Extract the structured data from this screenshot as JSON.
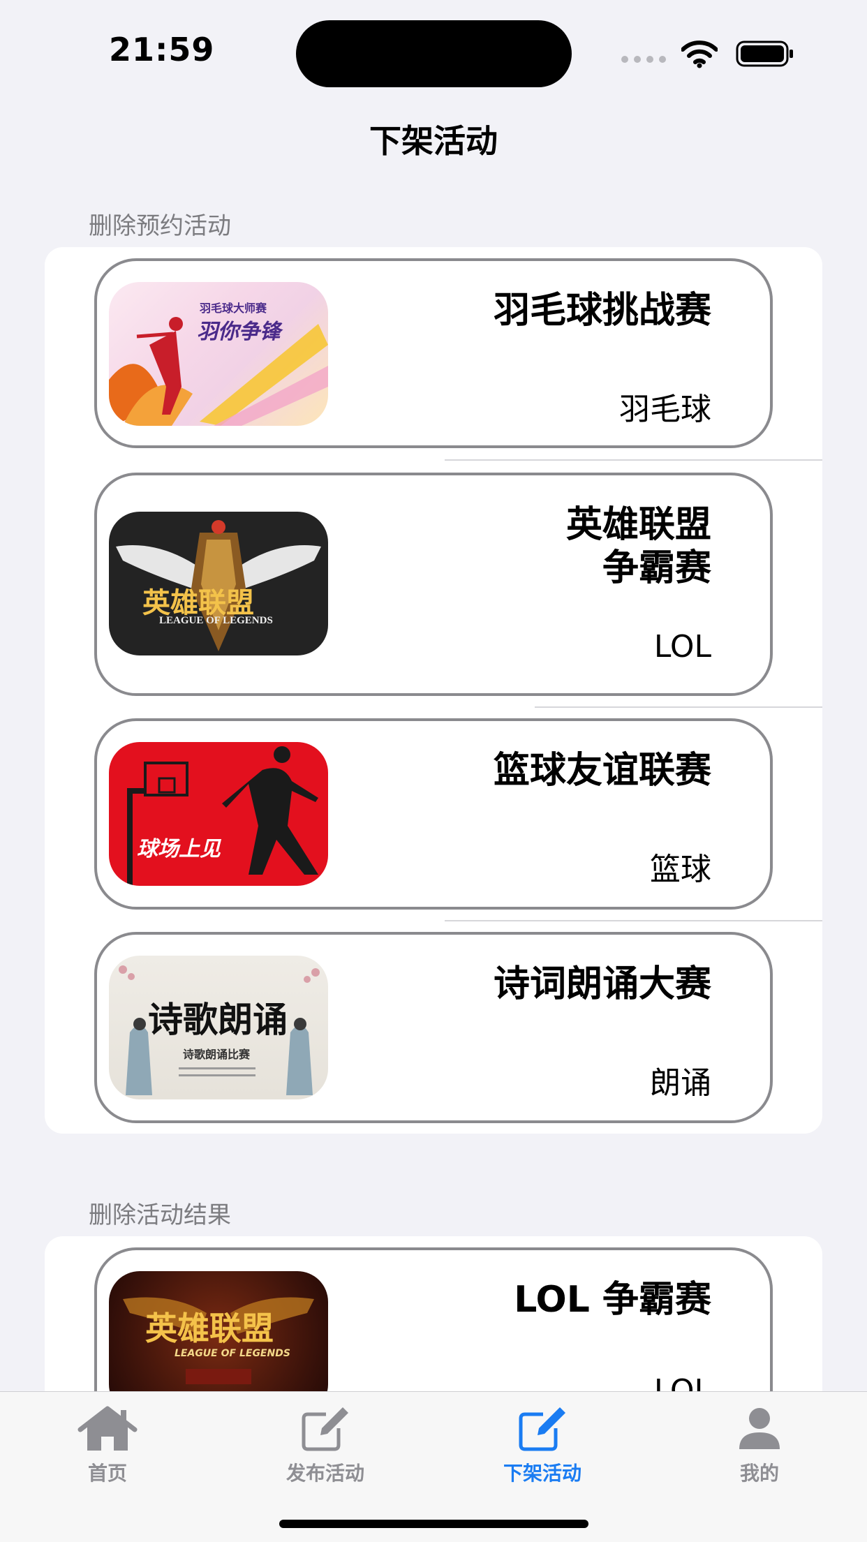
{
  "status_bar": {
    "time": "21:59"
  },
  "nav": {
    "title": "下架活动"
  },
  "sections": [
    {
      "header": "删除预约活动",
      "rows": [
        {
          "title": "羽毛球挑战赛",
          "subtitle": "羽毛球",
          "thumb": "badminton-poster",
          "thumb_text": "羽你争锋",
          "thumb_small": "羽毛球大师赛"
        },
        {
          "title": "英雄联盟\n争霸赛",
          "subtitle": "LOL",
          "thumb": "league-of-legends-logo",
          "thumb_text": "英雄联盟",
          "thumb_small": "LEAGUE OF LEGENDS"
        },
        {
          "title": "篮球友谊联赛",
          "subtitle": "篮球",
          "thumb": "basketball-poster",
          "thumb_text": "球场上见"
        },
        {
          "title": "诗词朗诵大赛",
          "subtitle": "朗诵",
          "thumb": "poetry-poster",
          "thumb_text": "诗歌朗诵",
          "thumb_small": "诗歌朗诵比赛"
        }
      ]
    },
    {
      "header": "删除活动结果",
      "rows": [
        {
          "title": "LOL 争霸赛",
          "subtitle": "LOL",
          "thumb": "lol-poster",
          "thumb_text": "英雄联盟",
          "thumb_small": "LEAGUE OF LEGENDS"
        }
      ]
    }
  ],
  "tabbar": {
    "tabs": [
      {
        "label": "首页",
        "icon": "house-icon",
        "active": false
      },
      {
        "label": "发布活动",
        "icon": "square-pencil-icon",
        "active": false
      },
      {
        "label": "下架活动",
        "icon": "square-pencil-icon",
        "active": true
      },
      {
        "label": "我的",
        "icon": "person-icon",
        "active": false
      }
    ]
  },
  "colors": {
    "accent": "#1a7cf2",
    "inactive": "#8e8e93",
    "background": "#f2f2f7",
    "row_border": "#8a8a8e"
  }
}
